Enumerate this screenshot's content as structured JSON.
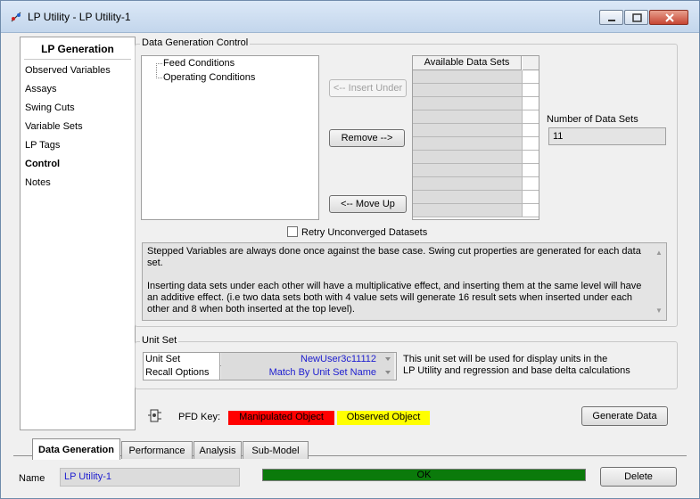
{
  "window": {
    "title": "LP Utility - LP Utility-1"
  },
  "nav": {
    "title": "LP Generation",
    "items": [
      {
        "label": "Observed Variables",
        "active": false
      },
      {
        "label": "Assays",
        "active": false
      },
      {
        "label": "Swing Cuts",
        "active": false
      },
      {
        "label": "Variable Sets",
        "active": false
      },
      {
        "label": "LP Tags",
        "active": false
      },
      {
        "label": "Control",
        "active": true
      },
      {
        "label": "Notes",
        "active": false
      }
    ]
  },
  "data_generation": {
    "group_label": "Data Generation Control",
    "tree_items": [
      "Feed Conditions",
      "Operating Conditions"
    ],
    "insert_under_label": "<-- Insert Under",
    "remove_label": "Remove -->",
    "move_up_label": "<-- Move Up",
    "grid_header": "Available Data Sets",
    "num_data_sets_label": "Number of Data Sets",
    "num_data_sets_value": "11",
    "retry_label": "Retry Unconverged Datasets",
    "retry_checked": false,
    "description_p1": "Stepped Variables are always done once against the base case.  Swing cut properties are generated for each data set.",
    "description_p2": "Inserting data sets under each other will have a multiplicative effect, and inserting them at the same level will have an additive effect. (i.e two data sets both with 4 value sets will generate 16 result sets when inserted under each other and 8 when both inserted at the top level)."
  },
  "unit_set": {
    "group_label": "Unit Set",
    "rows": [
      {
        "label": "Unit Set",
        "value": "NewUser3c11112"
      },
      {
        "label": "Recall Options",
        "value": "Match By Unit Set Name"
      }
    ],
    "note_line1": "This unit set will be used for display units in the",
    "note_line2": "LP Utility and regression and base delta calculations"
  },
  "pfd_key": {
    "label": "PFD Key:",
    "manipulated_label": "Manipulated Object",
    "manipulated_color": "#ff0000",
    "observed_label": "Observed Object",
    "observed_color": "#ffff00"
  },
  "generate_label": "Generate Data",
  "tabs": [
    "Data Generation",
    "Performance",
    "Analysis",
    "Sub-Model"
  ],
  "active_tab": "Data Generation",
  "footer": {
    "name_label": "Name",
    "name_value": "LP Utility-1",
    "status_text": "OK",
    "status_color": "#0b7a0b",
    "delete_label": "Delete"
  }
}
